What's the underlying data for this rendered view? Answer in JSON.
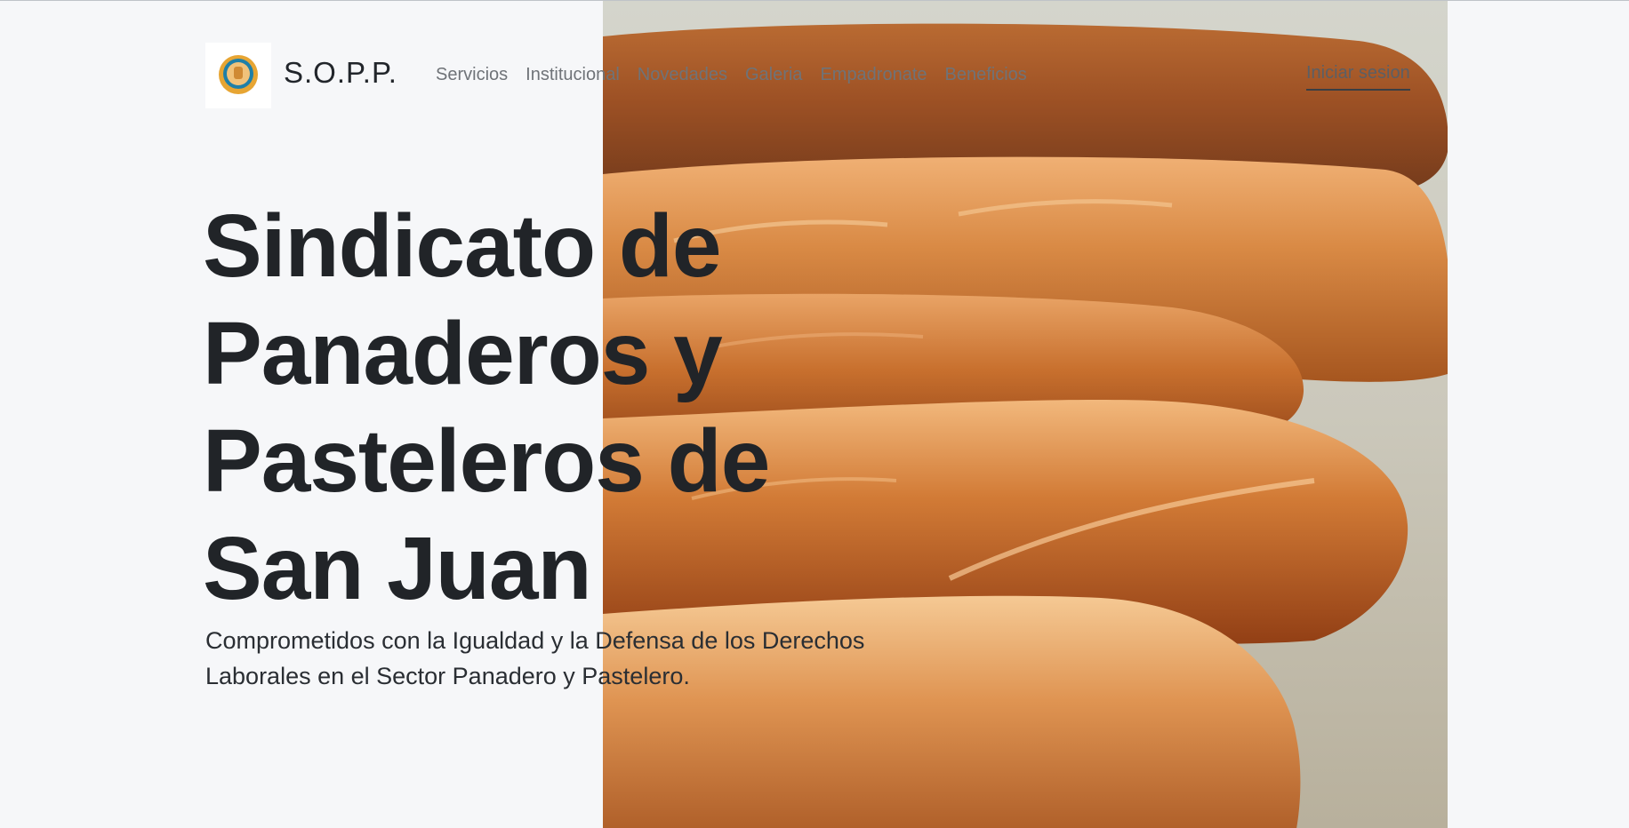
{
  "brand": {
    "name": "S.O.P.P.",
    "logo_icon": "union-fist-logo-icon"
  },
  "nav": {
    "items": [
      {
        "label": "Servicios"
      },
      {
        "label": "Institucional"
      },
      {
        "label": "Novedades"
      },
      {
        "label": "Galeria"
      },
      {
        "label": "Empadronate"
      },
      {
        "label": "Beneficios"
      }
    ],
    "login_label": "Iniciar sesion"
  },
  "hero": {
    "title": "Sindicato de Panaderos y Pasteleros de San Juan",
    "subtitle": "Comprometidos con la Igualdad y la Defensa de los Derechos Laborales en el Sector Panadero y Pastelero.",
    "image": "baguettes-photo"
  },
  "colors": {
    "background": "#f6f7f9",
    "text": "#212428",
    "nav_text": "#6f7378",
    "bread": "#c8702e"
  }
}
